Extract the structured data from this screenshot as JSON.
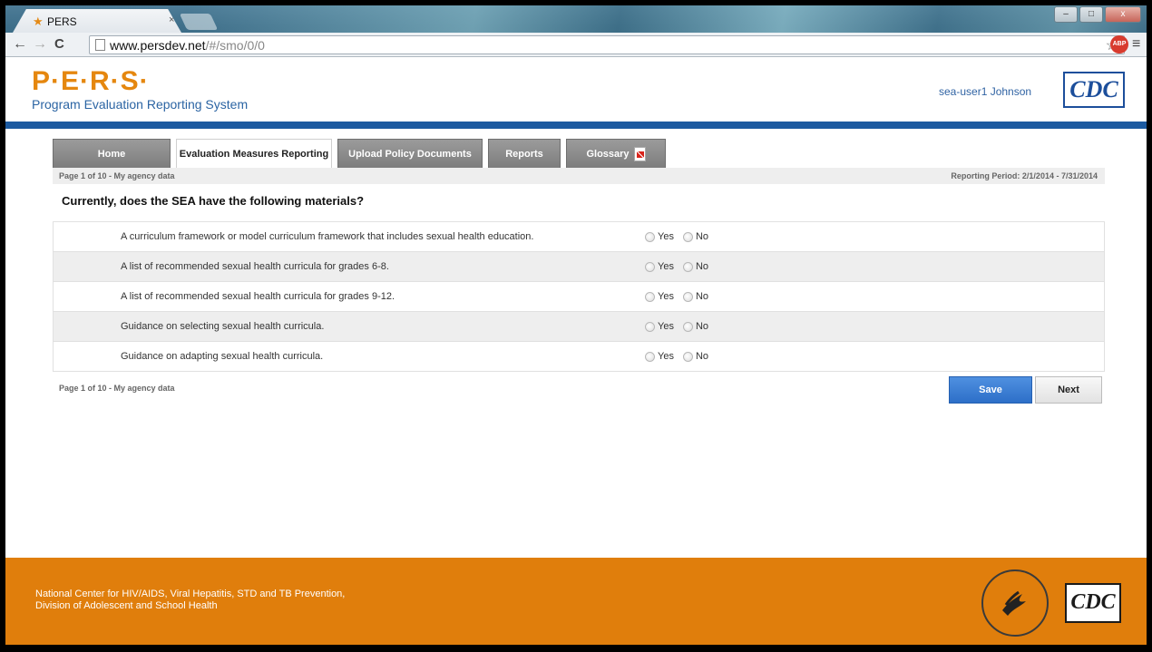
{
  "browser": {
    "tab_title": "PERS",
    "tab_close": "×",
    "url_host": "www.persdev.net",
    "url_path": "/#/smo/0/0",
    "back": "←",
    "forward": "→",
    "reload": "C",
    "star": "☆",
    "abp": "ABP",
    "menu": "≡",
    "win_minimize": "–",
    "win_maximize": "□",
    "win_close": "x"
  },
  "header": {
    "logo": "P·E·R·S·",
    "subtitle": "Program Evaluation Reporting System",
    "user": "sea-user1 Johnson",
    "cdc": "CDC"
  },
  "nav": {
    "tabs": [
      {
        "label": "Home"
      },
      {
        "label": "Evaluation Measures Reporting"
      },
      {
        "label": "Upload Policy Documents"
      },
      {
        "label": "Reports"
      },
      {
        "label": "Glossary"
      }
    ],
    "active_index": 1
  },
  "form": {
    "page_info": "Page 1 of 10 - My agency data",
    "reporting_period": "Reporting Period: 2/1/2014 - 7/31/2014",
    "question": "Currently, does the SEA have the following materials?",
    "yes_label": "Yes",
    "no_label": "No",
    "items": [
      {
        "text": "A curriculum framework or model curriculum framework that includes sexual health education."
      },
      {
        "text": "A list of recommended sexual health curricula for grades 6-8."
      },
      {
        "text": "A list of recommended sexual health curricula for grades 9-12."
      },
      {
        "text": "Guidance on selecting sexual health curricula."
      },
      {
        "text": "Guidance on adapting sexual health curricula."
      }
    ],
    "footer_page_info": "Page 1 of 10 - My agency data",
    "save_label": "Save",
    "next_label": "Next"
  },
  "footer": {
    "line1": "National Center for HIV/AIDS, Viral Hepatitis, STD and TB Prevention,",
    "line2": "Division of Adolescent and School Health",
    "cdc": "CDC"
  },
  "colors": {
    "brand_orange": "#e07e0c",
    "brand_blue": "#1c5aa0",
    "save_blue": "#2d6fc8"
  }
}
